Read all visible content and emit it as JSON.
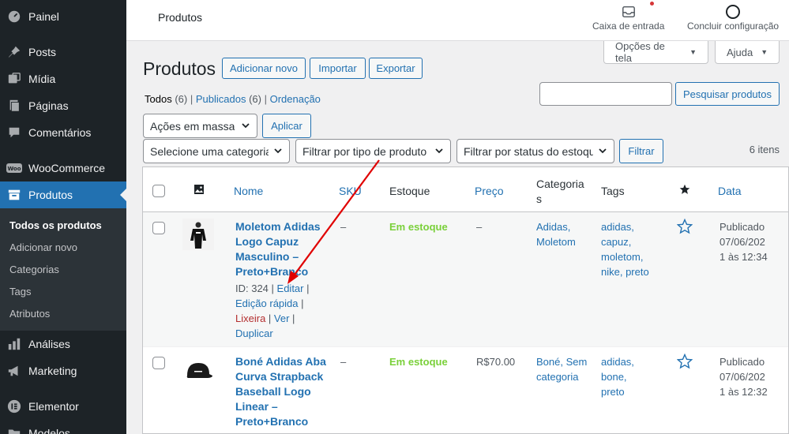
{
  "sidebar": {
    "items": [
      {
        "label": "Painel",
        "icon": "dashboard-icon"
      },
      {
        "label": "Posts",
        "icon": "pin-icon"
      },
      {
        "label": "Mídia",
        "icon": "media-icon"
      },
      {
        "label": "Páginas",
        "icon": "pages-icon"
      },
      {
        "label": "Comentários",
        "icon": "comments-icon"
      },
      {
        "label": "WooCommerce",
        "icon": "woocommerce-icon"
      },
      {
        "label": "Produtos",
        "icon": "archive-icon"
      },
      {
        "label": "Análises",
        "icon": "chart-icon"
      },
      {
        "label": "Marketing",
        "icon": "megaphone-icon"
      },
      {
        "label": "Elementor",
        "icon": "elementor-icon"
      },
      {
        "label": "Modelos",
        "icon": "folder-icon"
      }
    ],
    "submenu": [
      "Todos os produtos",
      "Adicionar novo",
      "Categorias",
      "Tags",
      "Atributos"
    ]
  },
  "topbar": {
    "page_title": "Produtos",
    "inbox_label": "Caixa de entrada",
    "setup_label": "Concluir configuração"
  },
  "screen_options": {
    "options_label": "Opções de tela",
    "help_label": "Ajuda"
  },
  "header": {
    "title": "Produtos",
    "add_new": "Adicionar novo",
    "import": "Importar",
    "export": "Exportar"
  },
  "views": {
    "all": "Todos",
    "all_count": "(6)",
    "published": "Publicados",
    "published_count": "(6)",
    "sorting": "Ordenação"
  },
  "search": {
    "button": "Pesquisar produtos",
    "value": ""
  },
  "bulk": {
    "select": "Ações em massa",
    "apply": "Aplicar"
  },
  "filters": {
    "category": "Selecione uma categoria",
    "product_type": "Filtrar por tipo de produto",
    "stock_status": "Filtrar por status do estoque",
    "button": "Filtrar",
    "items_count": "6 itens"
  },
  "table": {
    "columns": {
      "name": "Nome",
      "sku": "SKU",
      "stock": "Estoque",
      "price": "Preço",
      "categories_1": "Categoria",
      "categories_2": "s",
      "tags": "Tags",
      "date": "Data"
    },
    "rows": [
      {
        "name_lines": [
          "Moletom Adidas",
          "Logo Capuz",
          "Masculino –",
          "Preto+Branco"
        ],
        "id": "ID: 324",
        "edit": "Editar",
        "quick_edit": "Edição rápida",
        "trash": "Lixeira",
        "view": "Ver",
        "duplicate": "Duplicar",
        "sku": "–",
        "stock": "Em estoque",
        "price": "–",
        "categories_lines": [
          "Adidas,",
          "Moletom"
        ],
        "tags_lines": [
          "adidas,",
          "capuz,",
          "moletom,",
          "nike, preto"
        ],
        "date_lines": [
          "Publicado",
          "07/06/202",
          "1 às 12:34"
        ]
      },
      {
        "name_lines": [
          "Boné Adidas Aba",
          "Curva Strapback",
          "Baseball Logo",
          "Linear –",
          "Preto+Branco"
        ],
        "sku": "–",
        "stock": "Em estoque",
        "price": "R$70.00",
        "categories_lines": [
          "Boné, Sem",
          "categoria"
        ],
        "tags_lines": [
          "adidas,",
          "bone,",
          "preto"
        ],
        "date_lines": [
          "Publicado",
          "07/06/202",
          "1 às 12:32"
        ]
      }
    ]
  },
  "colors": {
    "accent": "#2271b1",
    "sidebar": "#1d2327",
    "stock": "#7ad03a",
    "trash": "#b32d2e",
    "annotation": "#e00000"
  }
}
